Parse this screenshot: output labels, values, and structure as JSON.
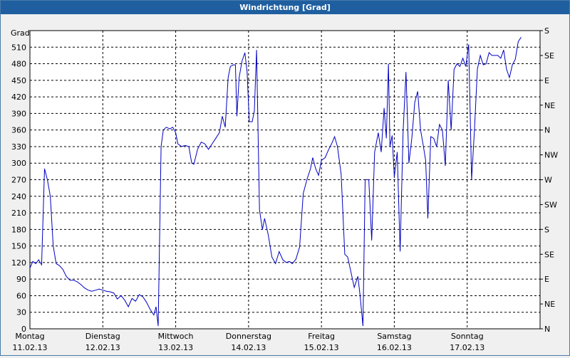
{
  "window": {
    "title": "Windrichtung [Grad]"
  },
  "chart_data": {
    "type": "line",
    "title": "Windrichtung [Grad]",
    "ylabel": "Grad",
    "ylim": [
      0,
      540
    ],
    "yticks": [
      0,
      30,
      60,
      90,
      120,
      150,
      180,
      210,
      240,
      270,
      300,
      330,
      360,
      390,
      420,
      450,
      480,
      510
    ],
    "right_labels": [
      "N",
      "NE",
      "E",
      "SE",
      "S",
      "SW",
      "W",
      "NW",
      "N",
      "NE",
      "E",
      "SE",
      "S"
    ],
    "x_labels": [
      {
        "day": "Montag",
        "date": "11.02.13"
      },
      {
        "day": "Dienstag",
        "date": "12.02.13"
      },
      {
        "day": "Mittwoch",
        "date": "13.02.13"
      },
      {
        "day": "Donnerstag",
        "date": "14.02.13"
      },
      {
        "day": "Freitag",
        "date": "15.02.13"
      },
      {
        "day": "Samstag",
        "date": "16.02.13"
      },
      {
        "day": "Sonntag",
        "date": "17.02.13"
      }
    ],
    "xlim_days": [
      0,
      7
    ],
    "grid": true,
    "color": "#0000c0",
    "series": [
      {
        "values": [
          [
            0.0,
            110
          ],
          [
            0.04,
            122
          ],
          [
            0.08,
            118
          ],
          [
            0.12,
            125
          ],
          [
            0.16,
            116
          ],
          [
            0.2,
            290
          ],
          [
            0.24,
            270
          ],
          [
            0.28,
            240
          ],
          [
            0.32,
            150
          ],
          [
            0.36,
            118
          ],
          [
            0.4,
            115
          ],
          [
            0.45,
            108
          ],
          [
            0.5,
            95
          ],
          [
            0.55,
            88
          ],
          [
            0.6,
            88
          ],
          [
            0.65,
            85
          ],
          [
            0.7,
            80
          ],
          [
            0.75,
            74
          ],
          [
            0.8,
            70
          ],
          [
            0.85,
            68
          ],
          [
            0.9,
            70
          ],
          [
            0.95,
            72
          ],
          [
            1.0,
            70
          ],
          [
            1.05,
            68
          ],
          [
            1.1,
            67
          ],
          [
            1.15,
            65
          ],
          [
            1.2,
            54
          ],
          [
            1.25,
            60
          ],
          [
            1.3,
            52
          ],
          [
            1.35,
            40
          ],
          [
            1.4,
            55
          ],
          [
            1.45,
            50
          ],
          [
            1.5,
            62
          ],
          [
            1.55,
            58
          ],
          [
            1.6,
            48
          ],
          [
            1.65,
            35
          ],
          [
            1.7,
            25
          ],
          [
            1.73,
            40
          ],
          [
            1.76,
            5
          ],
          [
            1.8,
            330
          ],
          [
            1.83,
            360
          ],
          [
            1.87,
            365
          ],
          [
            1.92,
            362
          ],
          [
            1.96,
            365
          ],
          [
            2.0,
            355
          ],
          [
            2.03,
            335
          ],
          [
            2.08,
            330
          ],
          [
            2.13,
            332
          ],
          [
            2.18,
            330
          ],
          [
            2.22,
            300
          ],
          [
            2.25,
            298
          ],
          [
            2.3,
            325
          ],
          [
            2.35,
            338
          ],
          [
            2.4,
            335
          ],
          [
            2.45,
            325
          ],
          [
            2.5,
            335
          ],
          [
            2.55,
            345
          ],
          [
            2.6,
            355
          ],
          [
            2.64,
            385
          ],
          [
            2.68,
            365
          ],
          [
            2.72,
            455
          ],
          [
            2.75,
            475
          ],
          [
            2.79,
            478
          ],
          [
            2.82,
            478
          ],
          [
            2.84,
            385
          ],
          [
            2.87,
            455
          ],
          [
            2.91,
            485
          ],
          [
            2.95,
            500
          ],
          [
            2.98,
            465
          ],
          [
            3.01,
            375
          ],
          [
            3.05,
            375
          ],
          [
            3.08,
            395
          ],
          [
            3.11,
            505
          ],
          [
            3.15,
            215
          ],
          [
            3.19,
            180
          ],
          [
            3.22,
            200
          ],
          [
            3.27,
            170
          ],
          [
            3.32,
            130
          ],
          [
            3.37,
            118
          ],
          [
            3.42,
            140
          ],
          [
            3.47,
            125
          ],
          [
            3.52,
            120
          ],
          [
            3.56,
            122
          ],
          [
            3.6,
            118
          ],
          [
            3.65,
            126
          ],
          [
            3.7,
            148
          ],
          [
            3.75,
            245
          ],
          [
            3.8,
            270
          ],
          [
            3.85,
            290
          ],
          [
            3.88,
            310
          ],
          [
            3.92,
            290
          ],
          [
            3.96,
            278
          ],
          [
            4.0,
            305
          ],
          [
            4.05,
            310
          ],
          [
            4.1,
            325
          ],
          [
            4.15,
            338
          ],
          [
            4.18,
            348
          ],
          [
            4.22,
            330
          ],
          [
            4.27,
            280
          ],
          [
            4.32,
            135
          ],
          [
            4.36,
            130
          ],
          [
            4.45,
            75
          ],
          [
            4.5,
            95
          ],
          [
            4.53,
            60
          ],
          [
            4.57,
            5
          ],
          [
            4.6,
            270
          ],
          [
            4.65,
            270
          ],
          [
            4.69,
            160
          ],
          [
            4.73,
            320
          ],
          [
            4.78,
            355
          ],
          [
            4.82,
            320
          ],
          [
            4.86,
            400
          ],
          [
            4.89,
            345
          ],
          [
            4.92,
            480
          ],
          [
            4.94,
            330
          ],
          [
            4.97,
            350
          ],
          [
            5.0,
            275
          ],
          [
            5.04,
            320
          ],
          [
            5.08,
            140
          ],
          [
            5.12,
            355
          ],
          [
            5.16,
            465
          ],
          [
            5.2,
            300
          ],
          [
            5.24,
            345
          ],
          [
            5.28,
            410
          ],
          [
            5.32,
            430
          ],
          [
            5.36,
            360
          ],
          [
            5.4,
            330
          ],
          [
            5.43,
            305
          ],
          [
            5.46,
            200
          ],
          [
            5.5,
            348
          ],
          [
            5.54,
            345
          ],
          [
            5.58,
            330
          ],
          [
            5.62,
            370
          ],
          [
            5.66,
            360
          ],
          [
            5.7,
            295
          ],
          [
            5.74,
            450
          ],
          [
            5.78,
            360
          ],
          [
            5.82,
            470
          ],
          [
            5.86,
            480
          ],
          [
            5.9,
            475
          ],
          [
            5.94,
            490
          ],
          [
            5.98,
            475
          ],
          [
            6.02,
            515
          ],
          [
            6.06,
            270
          ],
          [
            6.1,
            360
          ],
          [
            6.14,
            470
          ],
          [
            6.18,
            495
          ],
          [
            6.22,
            478
          ],
          [
            6.26,
            480
          ],
          [
            6.3,
            500
          ],
          [
            6.34,
            495
          ],
          [
            6.38,
            495
          ],
          [
            6.42,
            495
          ],
          [
            6.46,
            490
          ],
          [
            6.5,
            505
          ],
          [
            6.54,
            470
          ],
          [
            6.58,
            455
          ],
          [
            6.62,
            478
          ],
          [
            6.66,
            488
          ],
          [
            6.7,
            520
          ],
          [
            6.74,
            528
          ]
        ]
      }
    ]
  }
}
